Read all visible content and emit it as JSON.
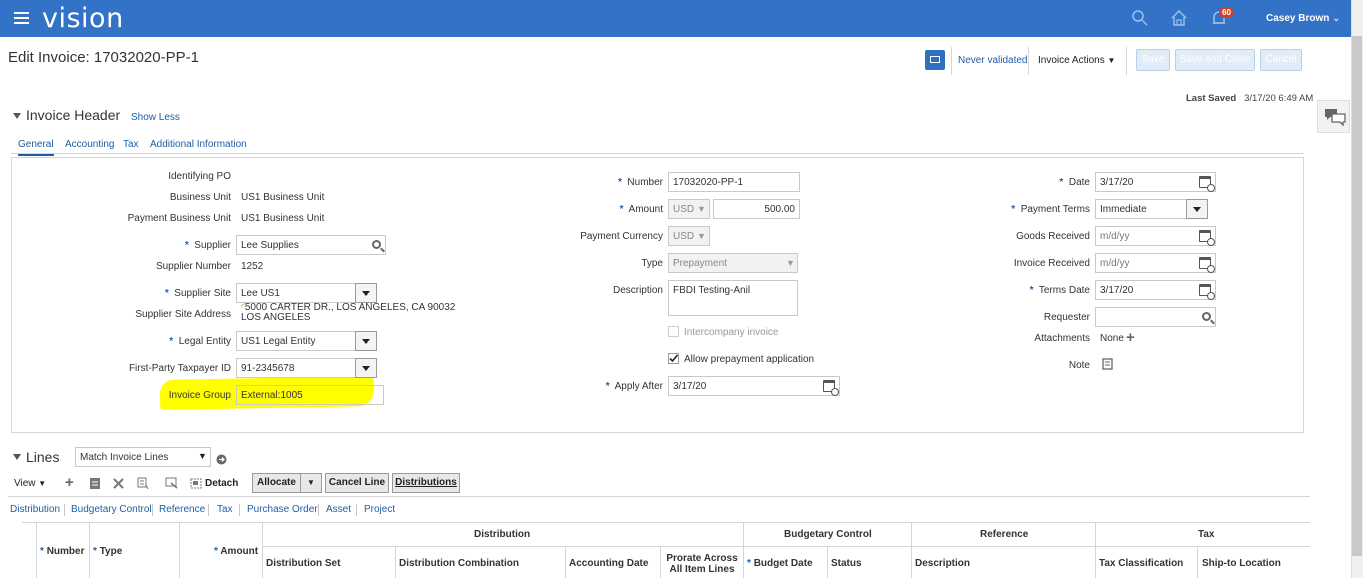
{
  "app": {
    "logo": "vision",
    "user_name": "Casey Brown",
    "notification_count": "60"
  },
  "page": {
    "title": "Edit Invoice: 17032020-PP-1",
    "validation_status": "Never validated",
    "invoice_actions": "Invoice Actions",
    "save": "Save",
    "save_and_close": "Save and Close",
    "cancel": "Cancel",
    "last_saved_label": "Last Saved",
    "last_saved_value": "3/17/20 6:49 AM"
  },
  "header": {
    "title": "Invoice Header",
    "show_less": "Show Less",
    "tabs": [
      "General",
      "Accounting",
      "Tax",
      "Additional Information"
    ]
  },
  "form_left": {
    "identifying_po_label": "Identifying PO",
    "business_unit_label": "Business Unit",
    "business_unit_value": "US1 Business Unit",
    "payment_bu_label": "Payment Business Unit",
    "payment_bu_value": "US1 Business Unit",
    "supplier_label": "Supplier",
    "supplier_value": "Lee Supplies",
    "supplier_number_label": "Supplier Number",
    "supplier_number_value": "1252",
    "supplier_site_label": "Supplier Site",
    "supplier_site_value": "Lee US1",
    "supplier_site_address_label": "Supplier Site Address",
    "supplier_site_address_line1": "5000 CARTER DR., LOS ANGELES, CA 90032",
    "supplier_site_address_line2": "LOS ANGELES",
    "legal_entity_label": "Legal Entity",
    "legal_entity_value": "US1 Legal Entity",
    "taxpayer_id_label": "First-Party Taxpayer ID",
    "taxpayer_id_value": "91-2345678",
    "invoice_group_label": "Invoice Group",
    "invoice_group_value": "External:1005"
  },
  "form_mid": {
    "number_label": "Number",
    "number_value": "17032020-PP-1",
    "amount_label": "Amount",
    "amount_currency": "USD",
    "amount_value": "500.00",
    "payment_currency_label": "Payment Currency",
    "payment_currency_value": "USD",
    "type_label": "Type",
    "type_value": "Prepayment",
    "description_label": "Description",
    "description_value": "FBDI Testing-Anil",
    "intercompany_label": "Intercompany invoice",
    "allow_prepay_label": "Allow prepayment application",
    "apply_after_label": "Apply After",
    "apply_after_value": "3/17/20"
  },
  "form_right": {
    "date_label": "Date",
    "date_value": "3/17/20",
    "payment_terms_label": "Payment Terms",
    "payment_terms_value": "Immediate",
    "goods_received_label": "Goods Received",
    "goods_received_placeholder": "m/d/yy",
    "invoice_received_label": "Invoice Received",
    "invoice_received_placeholder": "m/d/yy",
    "terms_date_label": "Terms Date",
    "terms_date_value": "3/17/20",
    "requester_label": "Requester",
    "attachments_label": "Attachments",
    "attachments_value": "None",
    "note_label": "Note"
  },
  "lines": {
    "title": "Lines",
    "match_select": "Match Invoice Lines",
    "view": "View",
    "detach": "Detach",
    "allocate": "Allocate",
    "cancel_line": "Cancel Line",
    "distributions": "Distributions",
    "links": [
      "Distribution",
      "Budgetary Control",
      "Reference",
      "Tax",
      "Purchase Order",
      "Asset",
      "Project"
    ],
    "group_headers": [
      "Distribution",
      "Budgetary Control",
      "Reference",
      "Tax"
    ],
    "columns": {
      "number": "Number",
      "type": "Type",
      "amount": "Amount",
      "distribution_set": "Distribution Set",
      "distribution_combination": "Distribution Combination",
      "accounting_date": "Accounting Date",
      "prorate_line1": "Prorate Across",
      "prorate_line2": "All Item Lines",
      "budget_date": "Budget Date",
      "status": "Status",
      "description": "Description",
      "tax_classification": "Tax Classification",
      "ship_to_location": "Ship-to Location"
    }
  },
  "colors": {
    "brand_blue": "#3273c7",
    "link_blue": "#1f5ea6",
    "highlight": "#ffff00"
  }
}
